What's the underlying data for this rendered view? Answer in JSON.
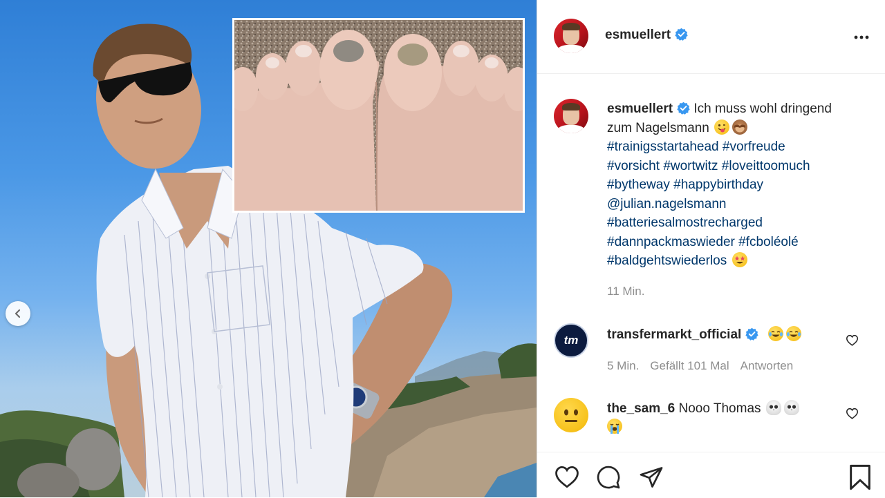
{
  "post": {
    "author": "esmuellert",
    "caption_lines": [
      [
        {
          "t": "Ich muss wohl dringend"
        }
      ],
      [
        {
          "t": "zum Nagelsmann "
        }
      ],
      [
        {
          "t": "#trainigsstartahead",
          "tag": true
        },
        {
          "t": " "
        },
        {
          "t": "#vorfreude",
          "tag": true
        }
      ],
      [
        {
          "t": "#vorsicht",
          "tag": true
        },
        {
          "t": " "
        },
        {
          "t": "#wortwitz",
          "tag": true
        },
        {
          "t": " "
        },
        {
          "t": "#loveittoomuch",
          "tag": true
        }
      ],
      [
        {
          "t": "#bytheway",
          "tag": true
        },
        {
          "t": " "
        },
        {
          "t": "#happybirthday",
          "tag": true
        }
      ],
      [
        {
          "t": "@julian.nagelsmann",
          "tag": true
        }
      ],
      [
        {
          "t": "#batteriesalmostrecharged",
          "tag": true
        }
      ],
      [
        {
          "t": "#dannpackmaswieder",
          "tag": true
        },
        {
          "t": " "
        },
        {
          "t": "#fcboléolé",
          "tag": true
        }
      ],
      [
        {
          "t": "#baldgehtswiederlos",
          "tag": true
        },
        {
          "t": " "
        }
      ]
    ],
    "time": "11 Min."
  },
  "comments": [
    {
      "user": "transfermarkt_official",
      "text": "",
      "time": "5 Min.",
      "likes": "Gefällt 101 Mal",
      "reply": "Antworten",
      "avatar_text": "tm"
    },
    {
      "user": "the_sam_6",
      "text": "Nooo Thomas"
    }
  ],
  "colors": {
    "verified": "#3897f0",
    "hashtag": "#00376b",
    "meta": "#8e8e8e"
  },
  "icons": {
    "more": "more-options-icon",
    "like": "heart-icon",
    "comment": "comment-icon",
    "share": "share-icon",
    "save": "bookmark-icon",
    "prev": "chevron-left-icon"
  }
}
